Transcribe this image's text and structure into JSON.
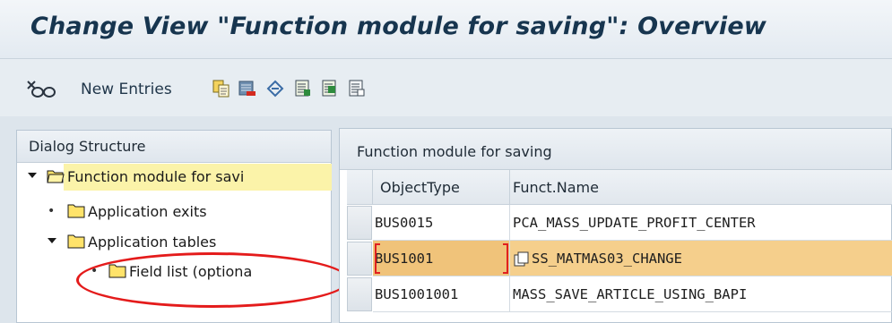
{
  "title": "Change View \"Function module for saving\": Overview",
  "toolbar": {
    "new_entries_label": "New Entries",
    "icons": [
      "display-change-icon",
      "copy-icon",
      "delete-icon",
      "undo-icon",
      "select-all-icon",
      "select-block-icon",
      "deselect-all-icon"
    ]
  },
  "dialog_structure": {
    "header": "Dialog Structure",
    "nodes": [
      {
        "label": "Function module for savi",
        "expanded": true,
        "selected": true
      },
      {
        "label": "Application exits"
      },
      {
        "label": "Application tables",
        "expanded": true
      },
      {
        "label": "Field list (optiona"
      }
    ]
  },
  "table": {
    "title": "Function module for saving",
    "columns": [
      "ObjectType",
      "Funct.Name"
    ],
    "rows": [
      {
        "object_type": "BUS0015",
        "funct_name": "PCA_MASS_UPDATE_PROFIT_CENTER"
      },
      {
        "object_type": "BUS1001",
        "funct_name": "SS_MATMAS03_CHANGE",
        "selected": true
      },
      {
        "object_type": "BUS1001001",
        "funct_name": "MASS_SAVE_ARTICLE_USING_BAPI"
      }
    ]
  },
  "colors": {
    "selection": "#f5cf8c",
    "tree_highlight": "#fbf3a9",
    "annotation": "#e41b1b",
    "title_text": "#17354f"
  }
}
